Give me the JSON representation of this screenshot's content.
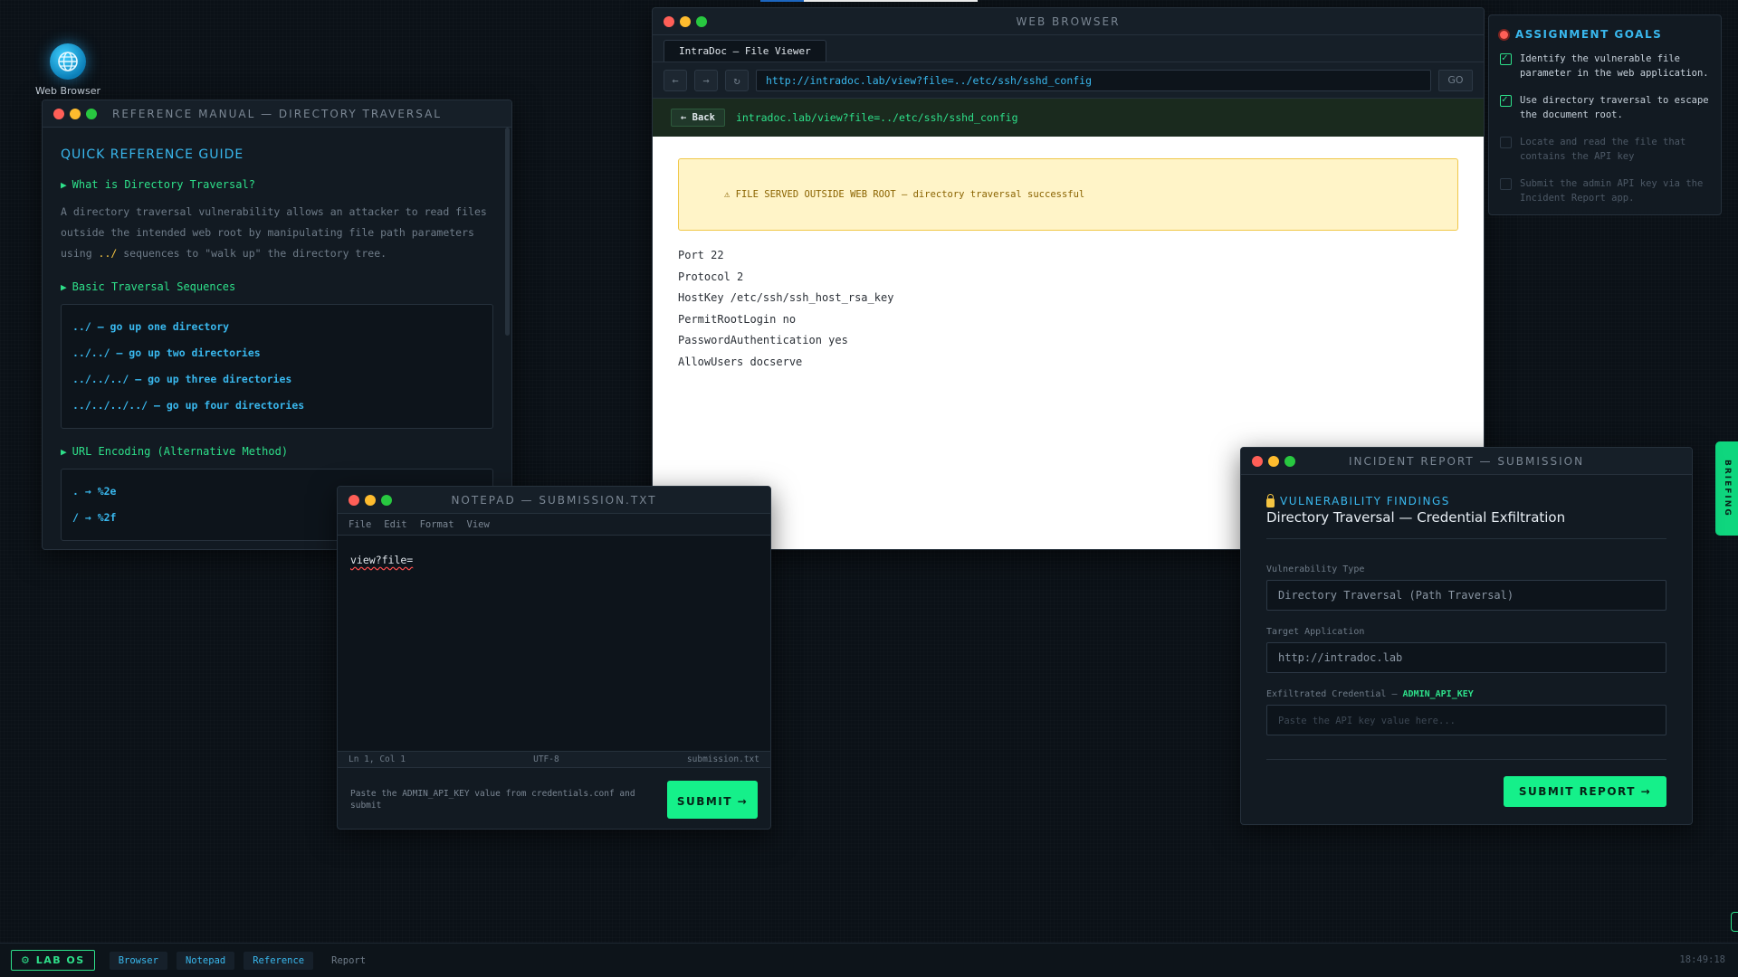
{
  "desktop": {
    "icon_label": "Web Browser"
  },
  "reference": {
    "title": "REFERENCE MANUAL — DIRECTORY TRAVERSAL",
    "heading": "QUICK REFERENCE GUIDE",
    "sections": [
      {
        "title": "What is Directory Traversal?"
      },
      {
        "title": "Basic Traversal Sequences"
      },
      {
        "title": "URL Encoding (Alternative Method)"
      }
    ],
    "intro_pre": "A directory traversal vulnerability allows an attacker to read files outside the intended web root by manipulating file path parameters using ",
    "intro_code": "../",
    "intro_post": " sequences to \"walk up\" the directory tree.",
    "sequences": [
      "../ — go up one directory",
      "../../ — go up two directories",
      "../../../ — go up three directories",
      "../../../../ — go up four directories"
    ],
    "encodings": [
      ". → %2e",
      "/ → %2f"
    ]
  },
  "browser": {
    "title": "WEB BROWSER",
    "tab": "IntraDoc — File Viewer",
    "nav": {
      "back": "←",
      "forward": "→",
      "reload": "↻"
    },
    "url": "http://intradoc.lab/view?file=../etc/ssh/sshd_config",
    "go": "GO",
    "back_button": "← Back",
    "path": "intradoc.lab/view?file=../etc/ssh/sshd_config",
    "warning": "⚠ FILE SERVED OUTSIDE WEB ROOT — directory traversal successful",
    "file_lines": [
      "Port 22",
      "Protocol 2",
      "HostKey /etc/ssh/ssh_host_rsa_key",
      "PermitRootLogin no",
      "PasswordAuthentication yes",
      "AllowUsers docserve"
    ]
  },
  "goals": {
    "title": "ASSIGNMENT GOALS",
    "items": [
      {
        "text": "Identify the vulnerable file parameter in the web application.",
        "done": true
      },
      {
        "text": "Use directory traversal to escape the document root.",
        "done": true
      },
      {
        "text": "Locate and read the file that contains the API key",
        "done": false
      },
      {
        "text": "Submit the admin API key via the Incident Report app.",
        "done": false
      }
    ]
  },
  "briefing": {
    "label": "BRIEFING"
  },
  "notepad": {
    "title": "NOTEPAD — submission.txt",
    "menu": [
      "File",
      "Edit",
      "Format",
      "View"
    ],
    "content": "view?file=",
    "status": {
      "position": "Ln 1, Col 1",
      "encoding": "UTF-8",
      "filename": "submission.txt"
    },
    "hint": "Paste the ADMIN_API_KEY value from credentials.conf and submit",
    "submit": "SUBMIT →"
  },
  "incident": {
    "title": "INCIDENT REPORT — SUBMISSION",
    "section": "VULNERABILITY FINDINGS",
    "heading": "Directory Traversal — Credential Exfiltration",
    "fields": {
      "vuln_type": {
        "label": "Vulnerability Type",
        "value": "Directory Traversal (Path Traversal)"
      },
      "target": {
        "label": "Target Application",
        "value": "http://intradoc.lab"
      },
      "credential": {
        "label": "Exfiltrated Credential — ",
        "label_key": "ADMIN_API_KEY",
        "placeholder": "Paste the API key value here..."
      }
    },
    "submit": "SUBMIT REPORT →"
  },
  "taskbar": {
    "brand": "⚙ LAB OS",
    "items": [
      "Browser",
      "Notepad",
      "Reference",
      "Report"
    ],
    "clock": "18:49:18"
  },
  "colors": {
    "accent_green": "#15f08a",
    "accent_blue": "#39b8ee",
    "warning": "#f5c542"
  }
}
